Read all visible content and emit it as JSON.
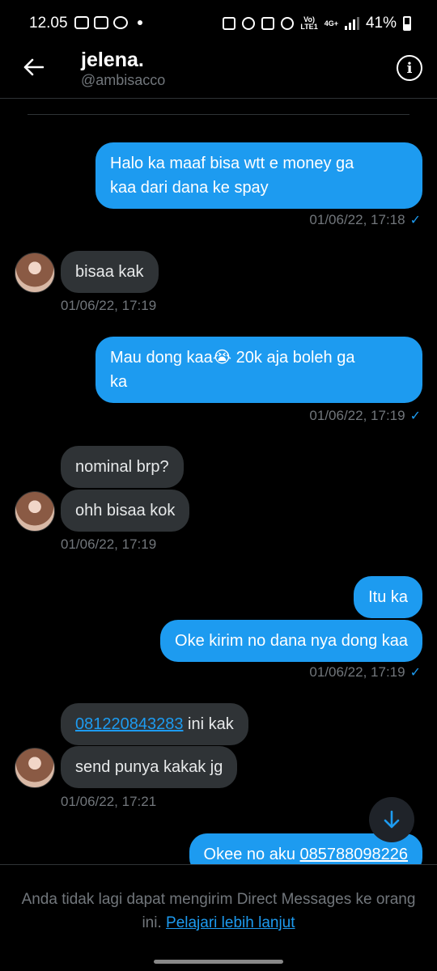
{
  "status_bar": {
    "time": "12.05",
    "battery": "41%",
    "net": "4G+"
  },
  "header": {
    "name": "jelena.",
    "handle": "@ambisacco"
  },
  "messages": {
    "m1": {
      "line1": "Halo ka maaf bisa wtt e money ga",
      "line2": "kaa dari dana ke spay",
      "time": "01/06/22, 17:18"
    },
    "m2": {
      "text": "bisaa kak",
      "time": "01/06/22, 17:19"
    },
    "m3": {
      "line1": "Mau dong kaa😭 20k aja boleh ga",
      "line2": "ka",
      "time": "01/06/22, 17:19"
    },
    "m4": {
      "text": "nominal brp?"
    },
    "m5": {
      "text": "ohh bisaa kok",
      "time": "01/06/22, 17:19"
    },
    "m6": {
      "text": "Itu ka"
    },
    "m7": {
      "text": "Oke kirim no dana nya dong kaa",
      "time": "01/06/22, 17:19"
    },
    "m8": {
      "link": "081220843283",
      "suffix": " ini kak"
    },
    "m9": {
      "text": "send punya kakak jg",
      "time": "01/06/22, 17:21"
    },
    "m10": {
      "prefix": "Okee no aku ",
      "link": "085788098226"
    }
  },
  "footer": {
    "text": "Anda tidak lagi dapat mengirim Direct Messages ke orang ini.",
    "link": "Pelajari lebih lanjut"
  },
  "colors": {
    "accent": "#1d9bf0",
    "bubble_in": "#2f3336",
    "muted": "#71767b"
  },
  "icons": [
    "back-arrow-icon",
    "info-icon",
    "check-icon",
    "scroll-down-arrow-icon"
  ]
}
